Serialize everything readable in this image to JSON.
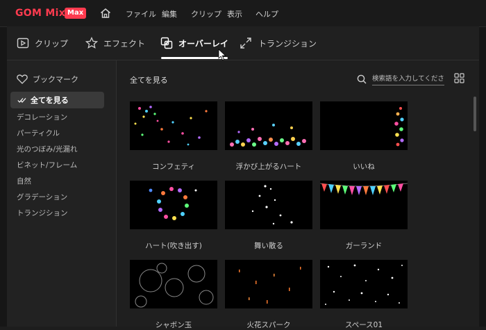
{
  "app": {
    "logo_text": "GOM Mix",
    "logo_badge": "Max",
    "menu": [
      "ファイル",
      "編集",
      "クリップ",
      "表示",
      "ヘルプ"
    ]
  },
  "tabs": [
    {
      "label": "クリップ",
      "icon": "clip-icon"
    },
    {
      "label": "エフェクト",
      "icon": "star-icon"
    },
    {
      "label": "オーバーレイ",
      "icon": "overlay-icon",
      "active": true
    },
    {
      "label": "トランジション",
      "icon": "transition-icon"
    }
  ],
  "sidebar": {
    "bookmark_label": "ブックマーク",
    "active_label": "全てを見る",
    "categories": [
      "デコレーション",
      "パーティクル",
      "光のつぼみ/光漏れ",
      "ビネット/フレーム",
      "自然",
      "グラデーション",
      "トランジション"
    ]
  },
  "content": {
    "section_title": "全てを見る",
    "search_placeholder": "検索語を入力してください。",
    "items": [
      {
        "label": "コンフェティ"
      },
      {
        "label": "浮かび上がるハート"
      },
      {
        "label": "いいね"
      },
      {
        "label": "ハート(吹き出す)"
      },
      {
        "label": "舞い散る"
      },
      {
        "label": "ガーランド"
      },
      {
        "label": "シャボン玉"
      },
      {
        "label": "火花スパーク"
      },
      {
        "label": "スペース01"
      }
    ]
  },
  "colors": {
    "accent": "#ff3b4f",
    "background": "#1d1d1d",
    "sidebar_active": "#3a3a3a"
  }
}
